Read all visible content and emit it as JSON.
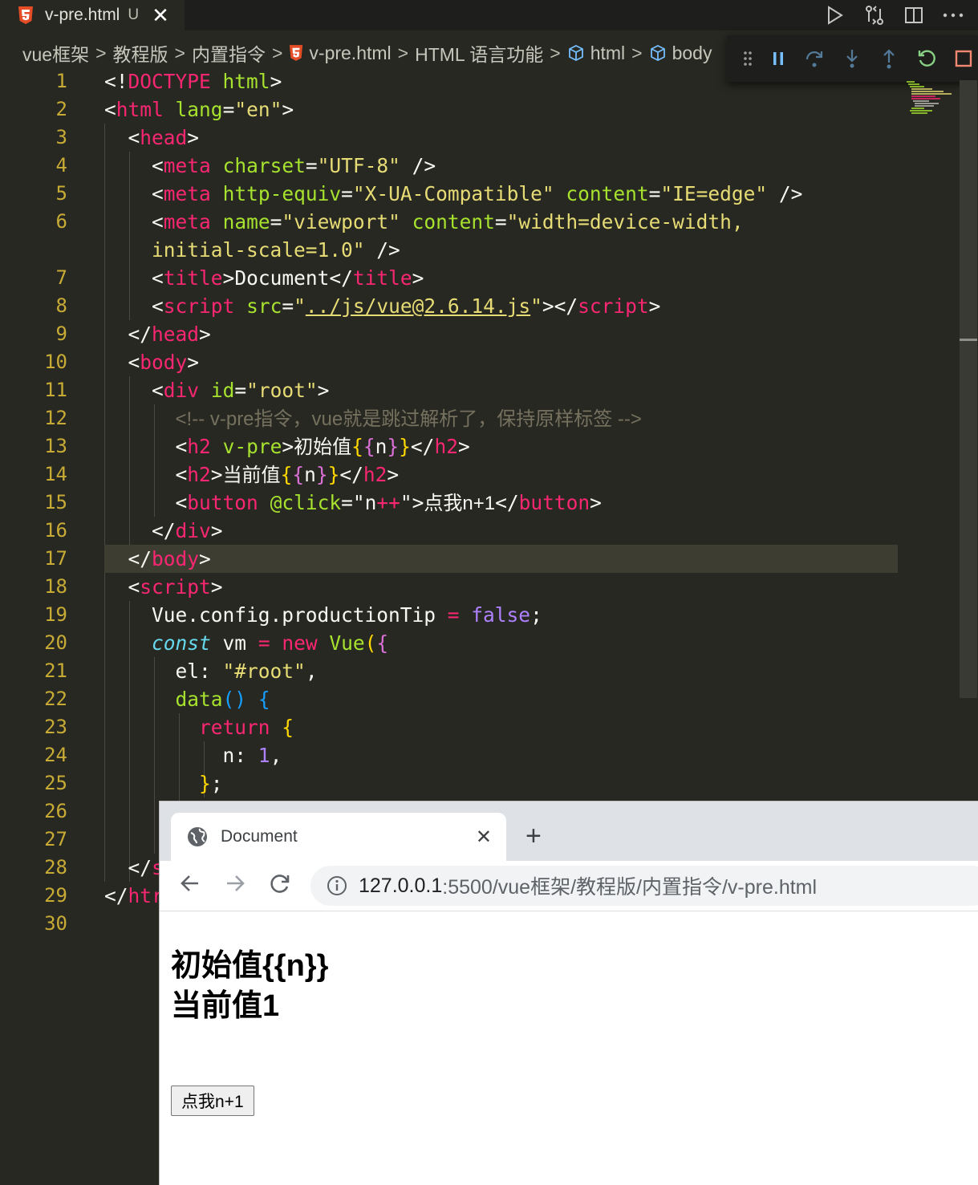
{
  "editor": {
    "tab": {
      "filename": "v-pre.html",
      "status": "U"
    },
    "breadcrumbs": [
      "vue框架",
      "教程版",
      "内置指令",
      "v-pre.html",
      "HTML 语言功能",
      "html",
      "body"
    ],
    "line_numbers": [
      "1",
      "2",
      "3",
      "4",
      "5",
      "6",
      "",
      "7",
      "8",
      "9",
      "10",
      "11",
      "12",
      "13",
      "14",
      "15",
      "16",
      "17",
      "18",
      "19",
      "20",
      "21",
      "22",
      "23",
      "24",
      "25",
      "26",
      "27",
      "28",
      "29",
      "30"
    ],
    "code": {
      "l1_doctype": "DOCTYPE",
      "l1_html": "html",
      "l2_tag": "html",
      "l2_attr": "lang",
      "l2_val": "\"en\"",
      "l3_tag": "head",
      "l4_tag": "meta",
      "l4_attr": "charset",
      "l4_val": "\"UTF-8\"",
      "l5_tag": "meta",
      "l5_attr1": "http-equiv",
      "l5_val1": "\"X-UA-Compatible\"",
      "l5_attr2": "content",
      "l5_val2": "\"IE=edge\"",
      "l6_tag": "meta",
      "l6_attr1": "name",
      "l6_val1": "\"viewport\"",
      "l6_attr2": "content",
      "l6_val2": "\"width=device-width,",
      "l6b_val": "initial-scale=1.0\"",
      "l7_tag": "title",
      "l7_text": "Document",
      "l8_tag": "script",
      "l8_attr": "src",
      "l8_q": "\"",
      "l8_path": "../js/vue@2.6.14.js",
      "l9_tag": "head",
      "l10_tag": "body",
      "l11_tag": "div",
      "l11_attr": "id",
      "l11_val": "\"root\"",
      "l12_comment": "<!-- v-pre指令，vue就是跳过解析了，保持原样标签 -->",
      "l13_tag": "h2",
      "l13_attr": "v-pre",
      "l13_text": "初始值",
      "l13_n": "n",
      "l14_tag": "h2",
      "l14_text": "当前值",
      "l14_n": "n",
      "l15_tag": "button",
      "l15_attr": "@click",
      "l15_v1": "n",
      "l15_v2": "++",
      "l15_text": "点我n+1",
      "l16_tag": "div",
      "l17_tag": "body",
      "l18_tag": "script",
      "l19_obj": "Vue.config.productionTip",
      "l19_val": "false",
      "l20_const": "const",
      "l20_name": "vm",
      "l20_new": "new",
      "l20_cls": "Vue",
      "l21_key": "el:",
      "l21_val": "\"#root\"",
      "l22_fn": "data",
      "l23_ret": "return",
      "l24_key": "n:",
      "l24_val": "1",
      "l28_text": "s",
      "l29_text": "htr"
    }
  },
  "browser": {
    "tab_title": "Document",
    "url_host": "127.0.0.1",
    "url_path": ":5500/vue框架/教程版/内置指令/v-pre.html",
    "heading1": "初始值{{n}}",
    "heading2": "当前值1",
    "button_label": "点我n+1"
  },
  "colors": {
    "editor_bg": "#272822",
    "tag": "#f92672",
    "attr": "#a6e22e",
    "string": "#e6db74",
    "line_number": "#c8ab35"
  }
}
